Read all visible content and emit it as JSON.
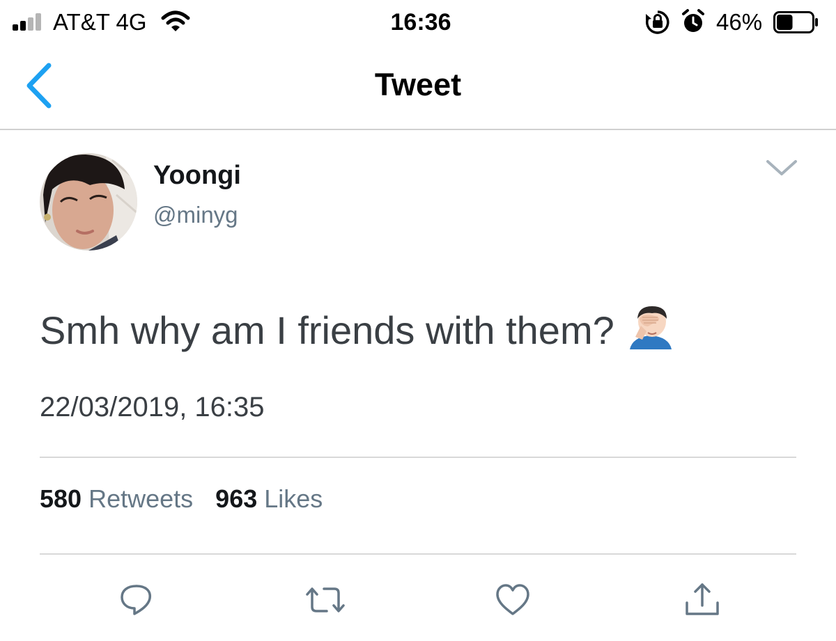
{
  "status_bar": {
    "carrier": "AT&T 4G",
    "time": "16:36",
    "battery_percent": "46%",
    "battery_level": 0.46,
    "signal_bars_filled": 2,
    "icons": [
      "signal-icon",
      "wifi-icon",
      "rotation-lock-icon",
      "alarm-icon",
      "battery-icon"
    ]
  },
  "nav": {
    "title": "Tweet",
    "back_icon": "chevron-left-icon"
  },
  "tweet": {
    "display_name": "Yoongi",
    "handle": "@minyg",
    "text": "Smh why am I friends with them?",
    "emoji": "facepalm-emoji",
    "timestamp": "22/03/2019, 16:35",
    "retweets_count": "580",
    "retweets_label": "Retweets",
    "likes_count": "963",
    "likes_label": "Likes",
    "more_icon": "chevron-down-icon"
  },
  "actions": [
    {
      "name": "reply",
      "icon": "reply-icon"
    },
    {
      "name": "retweet",
      "icon": "retweet-icon"
    },
    {
      "name": "like",
      "icon": "heart-icon"
    },
    {
      "name": "share",
      "icon": "share-icon"
    }
  ],
  "colors": {
    "accent": "#1da1f2",
    "secondary_text": "#657786",
    "icon_gray": "#657786",
    "divider": "#d8d8d8"
  }
}
